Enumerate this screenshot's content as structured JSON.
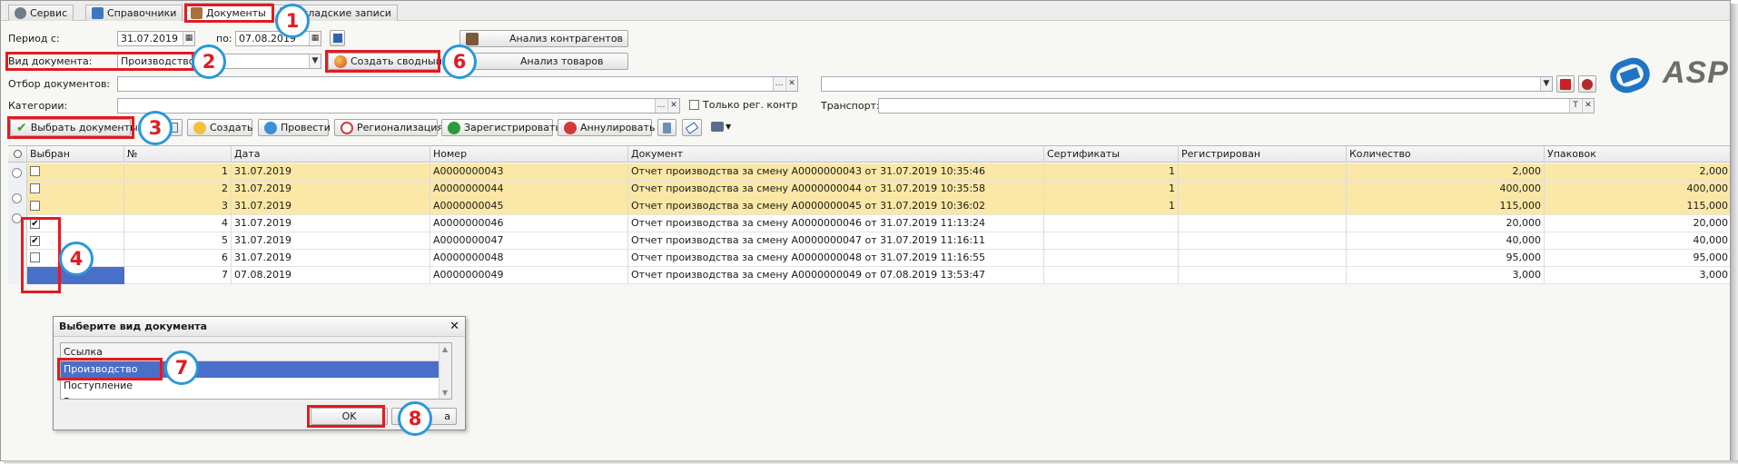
{
  "tabs": [
    {
      "label": "Сервис",
      "icon": "gear-icon"
    },
    {
      "label": "Справочники",
      "icon": "book-icon"
    },
    {
      "label": "Документы",
      "icon": "documents-icon"
    },
    {
      "label": "Складские записи",
      "icon": "warehouse-icon"
    }
  ],
  "filters": {
    "period_from_label": "Период с:",
    "period_from": "31.07.2019",
    "period_to_label": "по:",
    "period_to": "07.08.2019",
    "doc_type_label": "Вид документа:",
    "doc_type_value": "Производство",
    "selection_label": "Отбор документов:",
    "selection_value": "",
    "categories_label": "Категории:",
    "categories_value": "",
    "only_reg_label": "Только рег. контр",
    "transport_label": "Транспорт:",
    "transport_value": "",
    "analysis_partners": "Анализ контрагентов",
    "analysis_goods": "Анализ товаров",
    "create_summary": "Создать сводный"
  },
  "toolbar": {
    "select_docs": "Выбрать документы",
    "create": "Создать",
    "post": "Провести",
    "regionalize": "Регионализация",
    "register": "Зарегистрировать",
    "cancel": "Аннулировать"
  },
  "logo": {
    "text": "ASP"
  },
  "table": {
    "headers": [
      "Выбран",
      "№",
      "Дата",
      "Номер",
      "Документ",
      "Сертификаты",
      "Регистрирован",
      "Количество",
      "Упаковок"
    ],
    "rows": [
      {
        "checked": false,
        "highlight": true,
        "n": "1",
        "date": "31.07.2019",
        "number": "A0000000043",
        "doc": "Отчет производства за смену A0000000043 от 31.07.2019 10:35:46",
        "certs": "1",
        "registered": "",
        "qty": "2,000",
        "packs": "2,000"
      },
      {
        "checked": false,
        "highlight": true,
        "n": "2",
        "date": "31.07.2019",
        "number": "A0000000044",
        "doc": "Отчет производства за смену A0000000044 от 31.07.2019 10:35:58",
        "certs": "1",
        "registered": "",
        "qty": "400,000",
        "packs": "400,000"
      },
      {
        "checked": false,
        "highlight": true,
        "n": "3",
        "date": "31.07.2019",
        "number": "A0000000045",
        "doc": "Отчет производства за смену A0000000045 от 31.07.2019 10:36:02",
        "certs": "1",
        "registered": "",
        "qty": "115,000",
        "packs": "115,000"
      },
      {
        "checked": true,
        "highlight": false,
        "n": "4",
        "date": "31.07.2019",
        "number": "A0000000046",
        "doc": "Отчет производства за смену A0000000046 от 31.07.2019 11:13:24",
        "certs": "",
        "registered": "",
        "qty": "20,000",
        "packs": "20,000"
      },
      {
        "checked": true,
        "highlight": false,
        "n": "5",
        "date": "31.07.2019",
        "number": "A0000000047",
        "doc": "Отчет производства за смену A0000000047 от 31.07.2019 11:16:11",
        "certs": "",
        "registered": "",
        "qty": "40,000",
        "packs": "40,000"
      },
      {
        "checked": false,
        "highlight": false,
        "n": "6",
        "date": "31.07.2019",
        "number": "A0000000048",
        "doc": "Отчет производства за смену A0000000048 от 31.07.2019 11:16:55",
        "certs": "",
        "registered": "",
        "qty": "95,000",
        "packs": "95,000"
      },
      {
        "checked": true,
        "highlight": false,
        "n": "7",
        "date": "07.08.2019",
        "number": "A0000000049",
        "doc": "Отчет производства за смену A0000000049 от 07.08.2019 13:53:47",
        "certs": "",
        "registered": "",
        "qty": "3,000",
        "packs": "3,000"
      }
    ]
  },
  "dialog": {
    "title": "Выберите вид документа",
    "column": "Ссылка",
    "items": [
      "Производство",
      "Поступление",
      "В"
    ],
    "ok": "OK",
    "cancel_partial": "а"
  },
  "markers": [
    "1",
    "2",
    "3",
    "4",
    "6",
    "7",
    "8"
  ],
  "colors": {
    "highlight_row": "#fbe7a6",
    "selected_row": "#4a6fc8",
    "annotation_red": "#e11b22",
    "marker_border": "#2b97d8"
  }
}
